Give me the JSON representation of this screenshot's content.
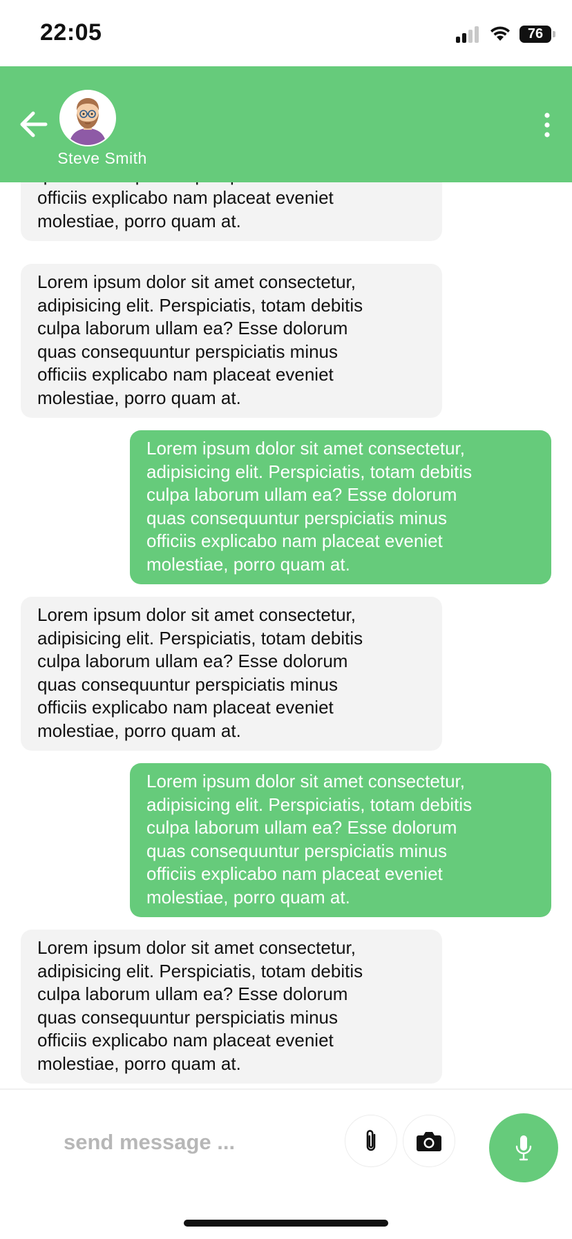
{
  "status_bar": {
    "time": "22:05",
    "battery": "76",
    "icons": [
      "cellular-signal-icon",
      "wifi-icon",
      "battery-icon"
    ]
  },
  "header": {
    "contact_name": "Steve Smith",
    "background_color": "#66cb7b",
    "icons": [
      "arrow-left-icon",
      "avatar-icon",
      "more-vertical-icon"
    ]
  },
  "messages": [
    {
      "direction": "incoming",
      "text": "Lorem ipsum dolor sit amet consectetur,\nadipisicing elit. Perspiciatis, totam debitis\nculpa laborum ullam ea? Esse dolorum\nquas consequuntur perspiciatis minus\nofficiis explicabo nam placeat eveniet\nmolestiae, porro quam at."
    },
    {
      "direction": "incoming",
      "text": "Lorem ipsum dolor sit amet consectetur,\nadipisicing elit. Perspiciatis, totam debitis\nculpa laborum ullam ea? Esse dolorum\nquas consequuntur perspiciatis minus\nofficiis explicabo nam placeat eveniet\nmolestiae, porro quam at."
    },
    {
      "direction": "outgoing",
      "text": "Lorem ipsum dolor sit amet consectetur,\nadipisicing elit. Perspiciatis, totam debitis\nculpa laborum ullam ea? Esse dolorum\nquas consequuntur perspiciatis minus\nofficiis explicabo nam placeat eveniet\nmolestiae, porro quam at."
    },
    {
      "direction": "incoming",
      "text": "Lorem ipsum dolor sit amet consectetur,\nadipisicing elit. Perspiciatis, totam debitis\nculpa laborum ullam ea? Esse dolorum\nquas consequuntur perspiciatis minus\nofficiis explicabo nam placeat eveniet\nmolestiae, porro quam at."
    },
    {
      "direction": "outgoing",
      "text": "Lorem ipsum dolor sit amet consectetur,\nadipisicing elit. Perspiciatis, totam debitis\nculpa laborum ullam ea? Esse dolorum\nquas consequuntur perspiciatis minus\nofficiis explicabo nam placeat eveniet\nmolestiae, porro quam at."
    },
    {
      "direction": "incoming",
      "text": "Lorem ipsum dolor sit amet consectetur,\nadipisicing elit. Perspiciatis, totam debitis\nculpa laborum ullam ea? Esse dolorum\nquas consequuntur perspiciatis minus\nofficiis explicabo nam placeat eveniet\nmolestiae, porro quam at."
    }
  ],
  "composer": {
    "placeholder": "send message ...",
    "value": "",
    "icons": [
      "paperclip-icon",
      "camera-icon",
      "microphone-icon"
    ],
    "accent_color": "#66cb7b"
  },
  "colors": {
    "incoming_bubble": "#f3f3f3",
    "outgoing_bubble": "#66cb7b",
    "incoming_text": "#111111",
    "outgoing_text": "#ffffff"
  }
}
